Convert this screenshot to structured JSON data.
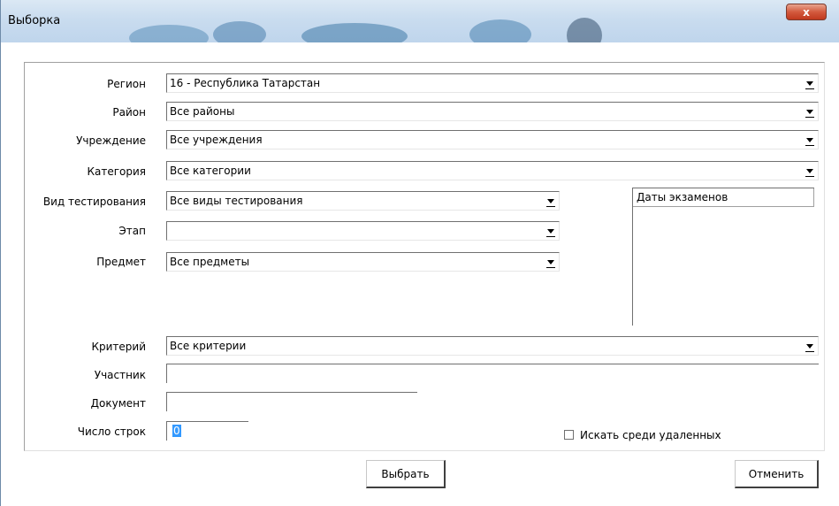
{
  "window": {
    "title": "Выборка",
    "close_label": "x"
  },
  "fields": {
    "region": {
      "label": "Регион",
      "value": "16 - Республика Татарстан"
    },
    "district": {
      "label": "Район",
      "value": "Все районы"
    },
    "institution": {
      "label": "Учреждение",
      "value": "Все учреждения"
    },
    "category": {
      "label": "Категория",
      "value": "Все категории"
    },
    "test_type": {
      "label": "Вид тестирования",
      "value": "Все виды тестирования"
    },
    "stage": {
      "label": "Этап",
      "value": ""
    },
    "subject": {
      "label": "Предмет",
      "value": "Все предметы"
    },
    "criterion": {
      "label": "Критерий",
      "value": "Все критерии"
    },
    "participant": {
      "label": "Участник",
      "value": ""
    },
    "document": {
      "label": "Документ",
      "value": ""
    },
    "row_count": {
      "label": "Число строк",
      "value": "0"
    }
  },
  "exam_dates": {
    "header": "Даты экзаменов"
  },
  "search_deleted": {
    "label": "Искать среди удаленных",
    "checked": false
  },
  "buttons": {
    "select": "Выбрать",
    "cancel": "Отменить"
  }
}
